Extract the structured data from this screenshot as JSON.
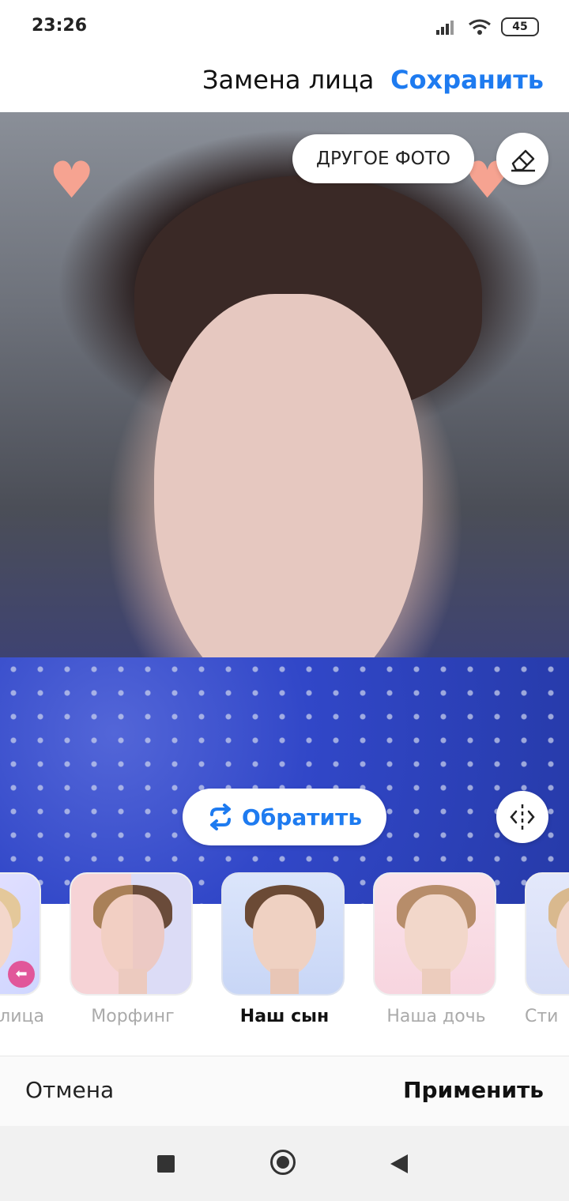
{
  "status_bar": {
    "time": "23:26",
    "battery": "45"
  },
  "header": {
    "title": "Замена лица",
    "save_label": "Сохранить"
  },
  "photo": {
    "other_photo_label": "ДРУГОЕ ФОТО",
    "flip_label": "Обратить"
  },
  "presets": [
    {
      "label": "лица",
      "active": false
    },
    {
      "label": "Морфинг",
      "active": false
    },
    {
      "label": "Наш сын",
      "active": true
    },
    {
      "label": "Наша дочь",
      "active": false
    },
    {
      "label": "Сти",
      "active": false
    }
  ],
  "footer": {
    "cancel_label": "Отмена",
    "apply_label": "Применить"
  },
  "colors": {
    "accent": "#1e7bf0"
  }
}
